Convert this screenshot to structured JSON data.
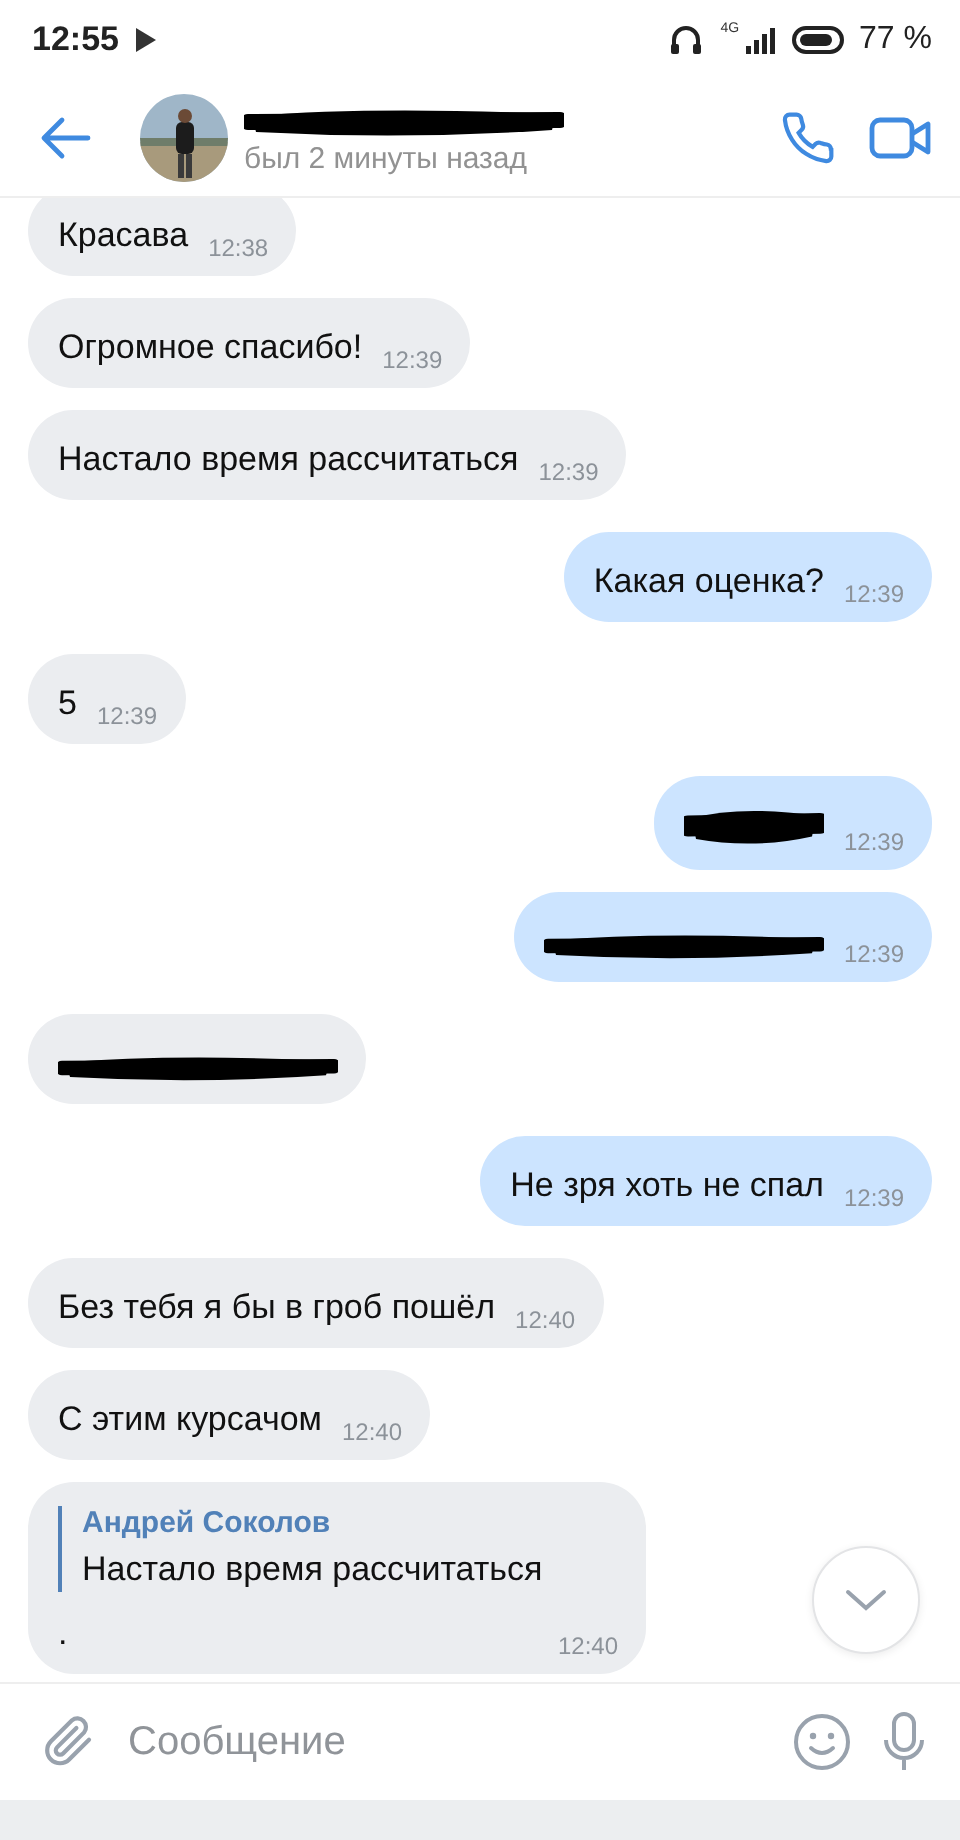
{
  "status_bar": {
    "time": "12:55",
    "network": "4G",
    "battery": "77 %"
  },
  "header": {
    "status": "был 2 минуты назад"
  },
  "messages": [
    {
      "kind": "text",
      "outgoing": false,
      "text": "Красава",
      "time": "12:38"
    },
    {
      "kind": "text",
      "outgoing": false,
      "text": "Огромное спасибо!",
      "time": "12:39"
    },
    {
      "kind": "text",
      "outgoing": false,
      "text": "Настало время рассчитаться",
      "time": "12:39"
    },
    {
      "kind": "text",
      "outgoing": true,
      "text": "Какая оценка?",
      "time": "12:39"
    },
    {
      "kind": "text",
      "outgoing": false,
      "text": "5",
      "time": "12:39"
    },
    {
      "kind": "blob",
      "outgoing": true,
      "time": "12:39"
    },
    {
      "kind": "scribble",
      "outgoing": true,
      "time": "12:39"
    },
    {
      "kind": "scribble",
      "outgoing": false
    },
    {
      "kind": "text",
      "outgoing": true,
      "text": "Не зря хоть не спал",
      "time": "12:39"
    },
    {
      "kind": "text",
      "outgoing": false,
      "text": "Без тебя я бы в гроб пошёл",
      "time": "12:40"
    },
    {
      "kind": "text",
      "outgoing": false,
      "text": "С этим курсачом",
      "time": "12:40"
    },
    {
      "kind": "reply",
      "outgoing": false,
      "quote_author": "Андрей Соколов",
      "quote_text": "Настало время рассчитаться",
      "text": ".",
      "time": "12:40"
    }
  ],
  "composer": {
    "placeholder": "Сообщение"
  }
}
